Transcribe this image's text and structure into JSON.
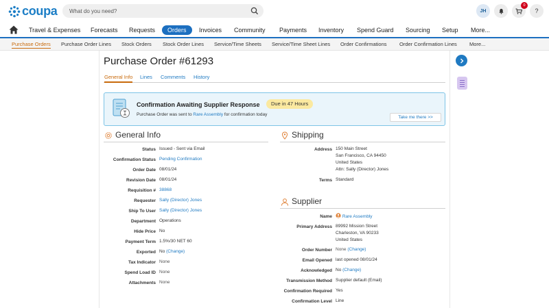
{
  "app": {
    "logo_text": "coupa"
  },
  "search": {
    "placeholder": "What do you need?"
  },
  "user": {
    "initials": "JH"
  },
  "cart": {
    "count": "0"
  },
  "help": {
    "label": "?"
  },
  "main_nav": {
    "items": [
      "Travel & Expenses",
      "Forecasts",
      "Requests",
      "Orders",
      "Invoices",
      "Community",
      "Payments",
      "Inventory",
      "Spend Guard",
      "Sourcing",
      "Setup",
      "More..."
    ],
    "active": "Orders"
  },
  "sub_nav": {
    "items": [
      "Purchase Orders",
      "Purchase Order Lines",
      "Stock Orders",
      "Stock Order Lines",
      "Service/Time Sheets",
      "Service/Time Sheet Lines",
      "Order Confirmations",
      "Order Confirmation Lines",
      "More..."
    ],
    "active": "Purchase Orders"
  },
  "page": {
    "title": "Purchase Order #61293"
  },
  "tabs": [
    "General Info",
    "Lines",
    "Comments",
    "History"
  ],
  "banner": {
    "title": "Confirmation Awaiting Supplier Response",
    "pill": "Due in 47 Hours",
    "msg_prefix": "Purchase Order was sent to ",
    "msg_link": "Rare Assembly",
    "msg_suffix": " for confirmation today",
    "button": "Take me there >>"
  },
  "general_info": {
    "title": "General Info",
    "labels": {
      "status": "Status",
      "confirmation_status": "Confirmation Status",
      "order_date": "Order Date",
      "revision_date": "Revision Date",
      "requisition": "Requisition #",
      "requester": "Requester",
      "ship_to_user": "Ship To User",
      "department": "Department",
      "hide_price": "Hide Price",
      "payment_term": "Payment Term",
      "exported": "Exported",
      "tax_indicator": "Tax Indicator",
      "spend_load_id": "Spend Load ID",
      "attachments": "Attachments"
    },
    "values": {
      "status": "Issued - Sent via Email",
      "confirmation_status": "Pending Confirmation",
      "order_date": "08/01/24",
      "revision_date": "08/01/24",
      "requisition": "38868",
      "requester": "Sally (Director) Jones",
      "ship_to_user": "Sally (Director) Jones",
      "department": "Operations",
      "hide_price": "No",
      "payment_term": "1.5%/30 NET 60",
      "exported": "No",
      "exported_change": "(Change)",
      "tax_indicator": "None",
      "spend_load_id": "None",
      "attachments": "None"
    }
  },
  "shipping": {
    "title": "Shipping",
    "labels": {
      "address": "Address",
      "terms": "Terms"
    },
    "values": {
      "address_line1": "150 Main Street",
      "address_line2": "San Francisco, CA 94450",
      "address_line3": "United States",
      "address_line4": "Attn: Sally (Director) Jones",
      "terms": "Standard"
    }
  },
  "supplier": {
    "title": "Supplier",
    "labels": {
      "name": "Name",
      "primary_address": "Primary Address",
      "order_number": "Order Number",
      "email_opened": "Email Opened",
      "acknowledged": "Acknowledged",
      "transmission_method": "Transmission Method",
      "confirmation_required": "Confirmation Required",
      "confirmation_level": "Confirmation Level"
    },
    "values": {
      "name": "Rare Assembly",
      "address_line1": "89992 Mission Street",
      "address_line2": "Charleston, VA 90233",
      "address_line3": "United States",
      "order_number": "None",
      "order_number_change": "(Change)",
      "email_opened": "last opened 08/01/24",
      "acknowledged": "No",
      "acknowledged_change": "(Change)",
      "transmission_method": "Supplier default (Email)",
      "confirmation_required": "Yes",
      "confirmation_level": "Line"
    }
  },
  "colors": {
    "brand_blue": "#1c6fc0",
    "active_orange": "#c8690a",
    "link_blue": "#1f7ac2",
    "banner_bg": "#eaf5fb",
    "pill_yellow": "#fbe9a0"
  }
}
